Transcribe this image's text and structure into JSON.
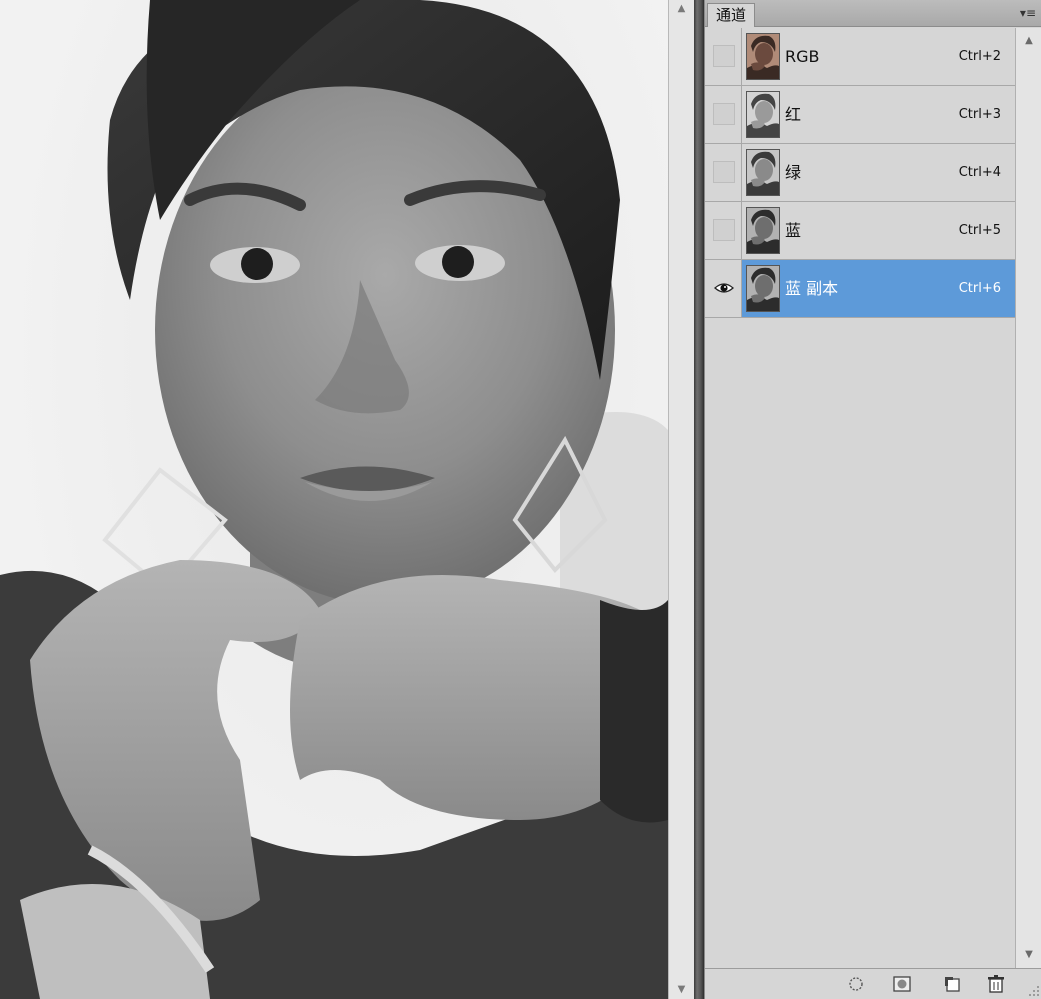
{
  "panel": {
    "tab_label": "通道",
    "menu_icon": "panel-menu-icon"
  },
  "channels": [
    {
      "name": "RGB",
      "shortcut": "Ctrl+2",
      "visible": false,
      "selected": false,
      "thumb": "color"
    },
    {
      "name": "红",
      "shortcut": "Ctrl+3",
      "visible": false,
      "selected": false,
      "thumb": "gray-light"
    },
    {
      "name": "绿",
      "shortcut": "Ctrl+4",
      "visible": false,
      "selected": false,
      "thumb": "gray"
    },
    {
      "name": "蓝",
      "shortcut": "Ctrl+5",
      "visible": false,
      "selected": false,
      "thumb": "gray-dark"
    },
    {
      "name": "蓝 副本",
      "shortcut": "Ctrl+6",
      "visible": true,
      "selected": true,
      "thumb": "gray-dark"
    }
  ],
  "footer_icons": [
    "load-selection-icon",
    "save-selection-icon",
    "new-channel-icon",
    "trash-icon"
  ],
  "colors": {
    "selected_row": "#5d9ad9",
    "panel_bg": "#d6d6d6",
    "header_bg": "#b2b2b2"
  }
}
